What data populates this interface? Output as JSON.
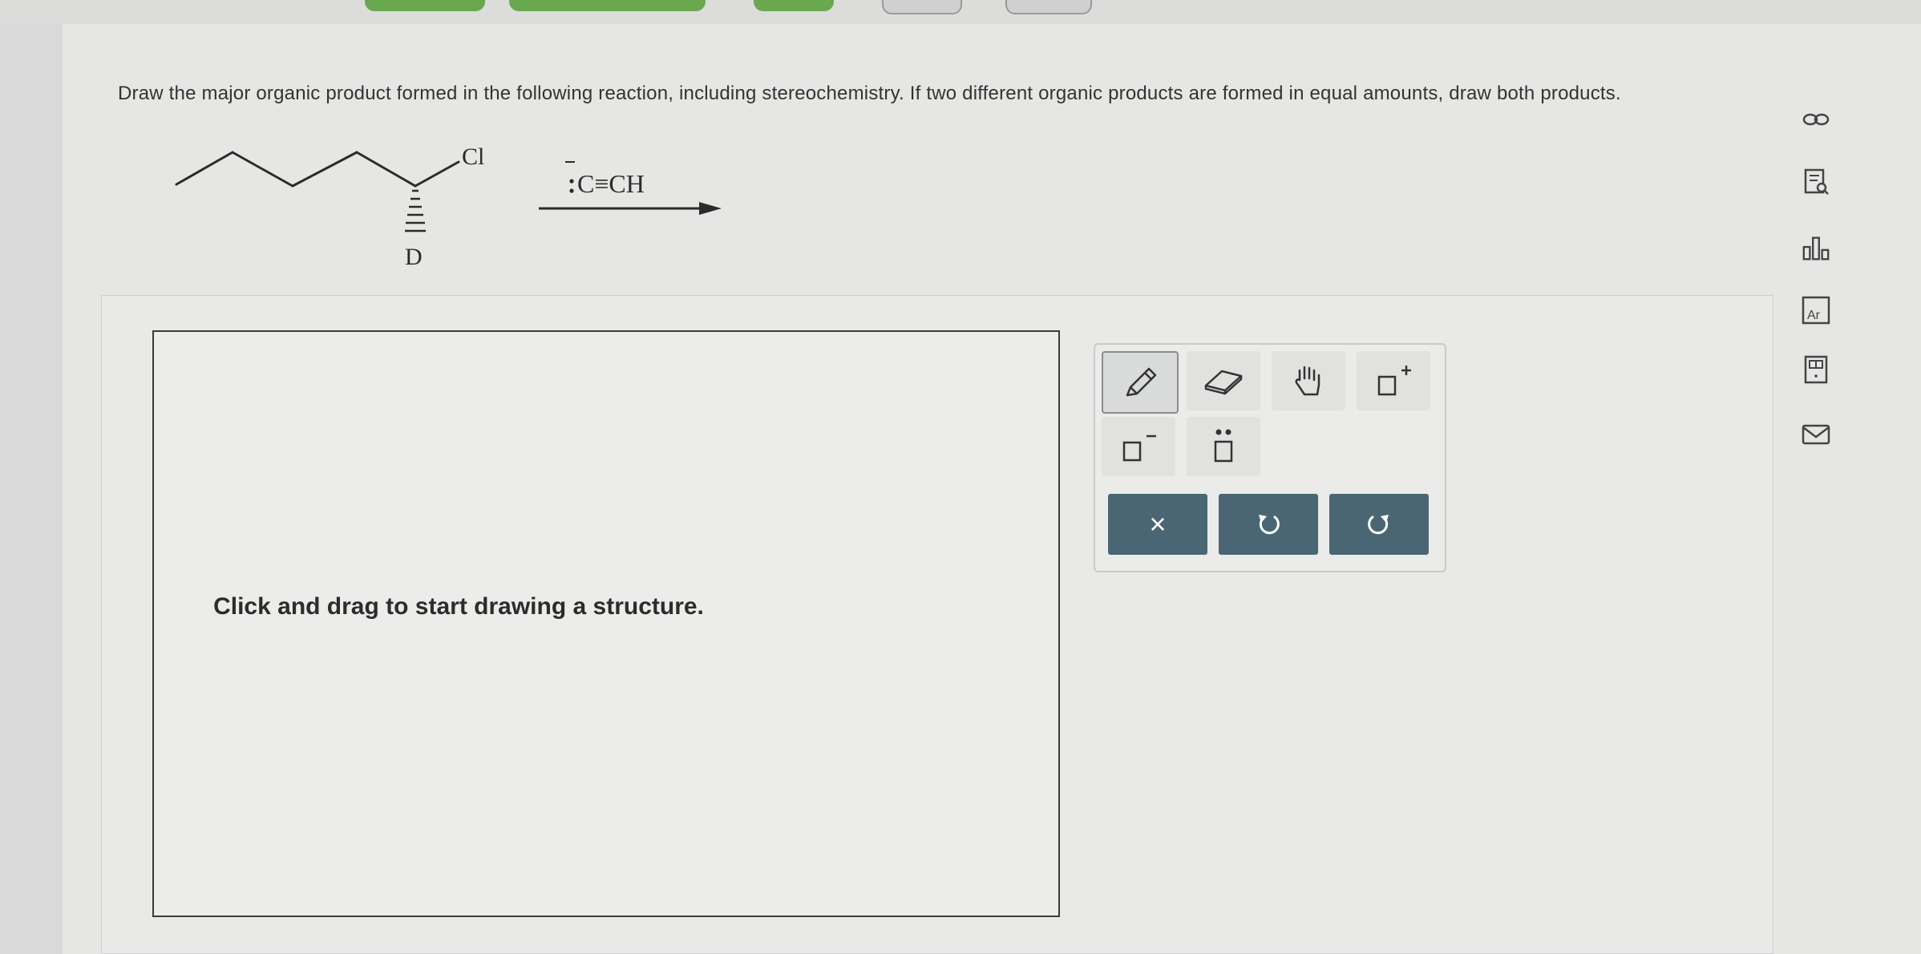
{
  "question": {
    "text": "Draw the major organic product formed in the following reaction, including stereochemistry. If two different organic products are formed in equal amounts, draw both products."
  },
  "reaction": {
    "substituent_top": "Cl",
    "substituent_bottom": "D",
    "reagent": "C≡CH"
  },
  "canvas": {
    "hint": "Click and drag to start drawing a structure."
  },
  "toolbar": {
    "tools": [
      "pencil-icon",
      "eraser-icon",
      "hand-icon",
      "positive-charge-icon",
      "negative-charge-icon",
      "lone-pair-icon"
    ],
    "actions": [
      "clear-icon",
      "undo-icon",
      "redo-icon"
    ],
    "clear_label": "×"
  },
  "side_toolbar": {
    "icons": [
      "link-icon",
      "search-document-icon",
      "chart-icon",
      "periodic-table-icon",
      "calculator-icon",
      "mail-icon"
    ],
    "periodic_label": "Ar"
  },
  "colors": {
    "action_button": "#4a6674",
    "tab_green": "#6aa84f"
  }
}
